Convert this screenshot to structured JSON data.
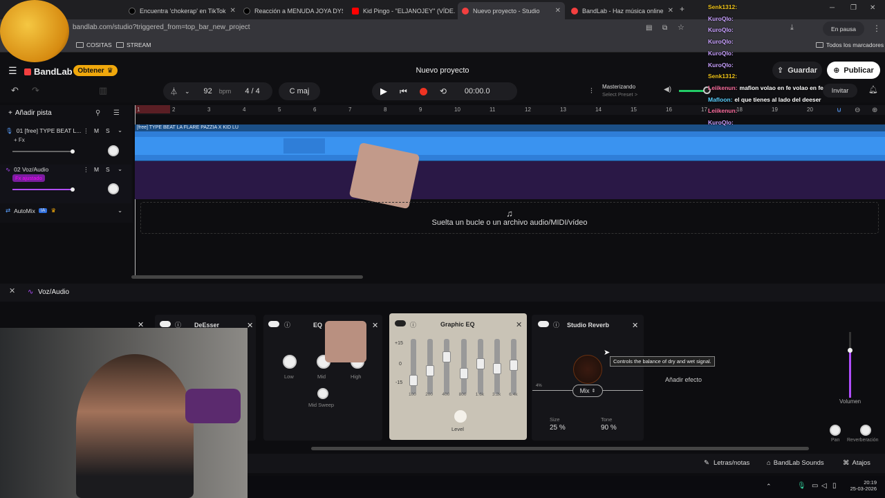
{
  "browser": {
    "tabs": [
      {
        "label": "Encuentra 'chokerap' en TikTok",
        "fav": "#000000"
      },
      {
        "label": "Reacción a MENUDA JOYA DYS...",
        "fav": "#000000"
      },
      {
        "label": "Kid Pingo - \"ELJANOJEY\" (VÍDE...",
        "fav": "#ff0000"
      },
      {
        "label": "Nuevo proyecto - Studio",
        "fav": "#f33f3f"
      },
      {
        "label": "BandLab - Haz música online",
        "fav": "#f33f3f"
      }
    ],
    "url": "bandlab.com/studio?triggered_from=top_bar_new_project",
    "paused": "En pausa",
    "bookmarks": [
      "COSITAS",
      "STREAM"
    ],
    "all_bookmarks": "Todos los marcadores"
  },
  "app": {
    "logo": "BandLab",
    "upgrade": "Obtener",
    "project_name": "Nuevo proyecto",
    "save": "Guardar",
    "publish": "Publicar",
    "invite": "Invitar",
    "tempo": "92",
    "tempo_unit": "bpm",
    "time_sig": "4 / 4",
    "key": "C maj",
    "time": "00:00.0",
    "mastering_title": "Masterizando",
    "mastering_sub": "Select Preset >"
  },
  "tracks": {
    "add": "Añadir pista",
    "items": [
      {
        "name": "01  [free] TYPE BEAT L...",
        "fx": "+ Fx"
      },
      {
        "name": "02  Voz/Audio",
        "fx": "Fx ajustado"
      }
    ],
    "automix": "AutoMix",
    "ai_badge": "IA",
    "clip_label": "[free] TYPE BEAT LA FLARE PAZZIA X KID LU"
  },
  "ruler": [
    "1",
    "2",
    "3",
    "4",
    "5",
    "6",
    "7",
    "8",
    "9",
    "10",
    "11",
    "12",
    "13",
    "14",
    "15",
    "16",
    "17",
    "18",
    "19",
    "20"
  ],
  "dropzone": "Suelta un bucle o un archivo audio/MIDI/vídeo",
  "fx": {
    "track": "Voz/Audio",
    "cards": [
      "DeEsser",
      "EQ",
      "Graphic EQ",
      "Studio Reverb"
    ],
    "eq_knobs": [
      "Low",
      "Mid",
      "High",
      "Mid Sweep"
    ],
    "geq_scale": [
      "+15",
      "0",
      "-15"
    ],
    "geq_bands": [
      "100",
      "200",
      "400",
      "800",
      "1.6k",
      "3.2k",
      "6.4k"
    ],
    "level": "Level",
    "mix_tooltip": "Controls the balance of dry and wet signal.",
    "mix": "Mix",
    "size_label": "Size",
    "size": "25 %",
    "tone_label": "Tone",
    "tone": "90 %",
    "add_effect": "Añadir efecto",
    "volume": "Volumen",
    "pan": "Pan",
    "reverb": "Reverberación"
  },
  "bottom": {
    "lyrics": "Letras/notas",
    "sounds": "BandLab Sounds",
    "shortcuts": "Atajos"
  },
  "taskbar": {
    "time": "20:19",
    "date": "25-03-2026"
  },
  "chat": [
    {
      "user": "Senk1312:",
      "msg": "",
      "color": "#f0c419"
    },
    {
      "user": "KuroQlo:",
      "msg": "",
      "color": "#c8a0ff"
    },
    {
      "user": "KuroQlo:",
      "msg": "",
      "color": "#c8a0ff"
    },
    {
      "user": "KuroQlo:",
      "msg": "",
      "color": "#c8a0ff"
    },
    {
      "user": "KuroQlo:",
      "msg": "",
      "color": "#c8a0ff"
    },
    {
      "user": "KuroQlo:",
      "msg": "",
      "color": "#c8a0ff"
    },
    {
      "user": "Senk1312:",
      "msg": "",
      "color": "#f0c419"
    },
    {
      "user": "Leiikenun:",
      "msg": "mafion volao en fe volao en fe",
      "color": "#ff6fa0"
    },
    {
      "user": "Mafloon:",
      "msg": "el que tienes al lado del deeser",
      "color": "#5ad1ff"
    },
    {
      "user": "Leiikenun:",
      "msg": "",
      "color": "#ff6fa0"
    },
    {
      "user": "KuroQlo:",
      "msg": "",
      "color": "#c8a0ff"
    }
  ]
}
